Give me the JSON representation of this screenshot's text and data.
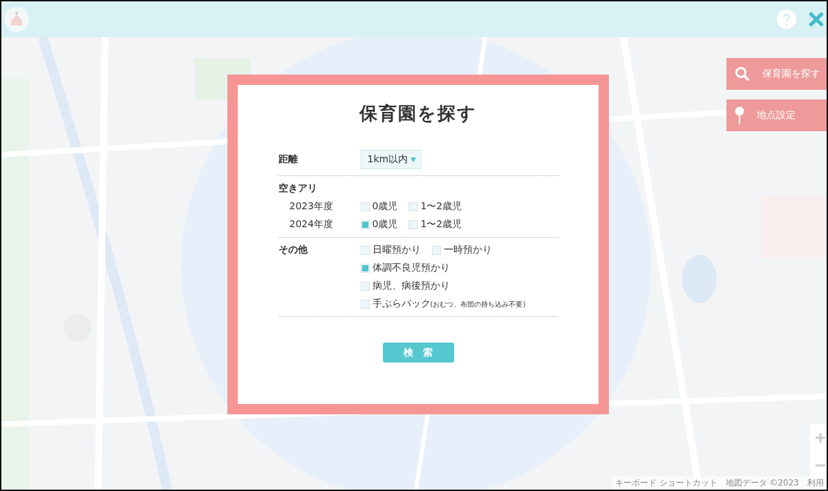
{
  "map_buttons": [
    {
      "kind": "search",
      "label": "保育園を探す"
    },
    {
      "kind": "pin",
      "label": "地点設定"
    }
  ],
  "dialog": {
    "title": "保育園を探す",
    "sections": [
      {
        "kind": "select",
        "label": "距離",
        "value": "1km以内"
      },
      {
        "kind": "checks",
        "label": "空きアリ",
        "rows": [
          {
            "label": "2023年度",
            "options": [
              {
                "label": "0歳児",
                "checked": false
              },
              {
                "label": "1〜2歳児",
                "checked": false
              }
            ]
          },
          {
            "label": "2024年度",
            "options": [
              {
                "label": "0歳児",
                "checked": true
              },
              {
                "label": "1〜2歳児",
                "checked": false
              }
            ]
          }
        ]
      },
      {
        "kind": "checks",
        "label": "その他",
        "rows": [
          {
            "options": [
              {
                "label": "日曜預かり",
                "checked": false
              },
              {
                "label": "一時預かり",
                "checked": false
              }
            ]
          },
          {
            "options": [
              {
                "label": "体調不良児預かり",
                "checked": true
              }
            ]
          },
          {
            "options": [
              {
                "label": "病児、病後預かり",
                "checked": false
              }
            ]
          },
          {
            "options": [
              {
                "label": "手ぶらパック",
                "note": "(おむつ、布団の持ち込み不要)",
                "checked": false
              }
            ]
          }
        ]
      }
    ],
    "search_button": "検　索"
  },
  "attribution": [
    "キーボード ショートカット",
    "地図データ ©2023",
    "利用"
  ]
}
